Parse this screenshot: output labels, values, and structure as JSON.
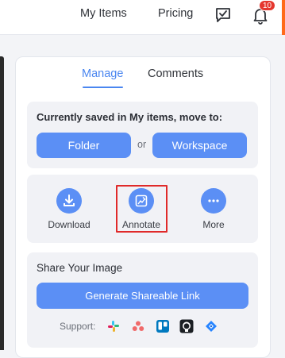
{
  "nav": {
    "my_items": "My Items",
    "pricing": "Pricing",
    "notification_count": "10"
  },
  "tabs": [
    {
      "label": "Manage",
      "active": true
    },
    {
      "label": "Comments",
      "active": false
    }
  ],
  "move_card": {
    "title": "Currently saved in My items, move to:",
    "folder_label": "Folder",
    "or_label": "or",
    "workspace_label": "Workspace"
  },
  "actions": [
    {
      "label": "Download",
      "icon": "download-icon"
    },
    {
      "label": "Annotate",
      "icon": "annotate-icon",
      "highlighted": true
    },
    {
      "label": "More",
      "icon": "more-dots-icon"
    }
  ],
  "share_card": {
    "title": "Share Your Image",
    "generate_label": "Generate Shareable Link",
    "support_label": "Support:",
    "integrations": [
      "slack-icon",
      "asana-icon",
      "trello-icon",
      "github-icon",
      "jira-icon"
    ]
  },
  "colors": {
    "accent": "#5b8ff5",
    "tab_active": "#4a86f0",
    "badge": "#e5372e",
    "highlight": "#e02a2a"
  }
}
